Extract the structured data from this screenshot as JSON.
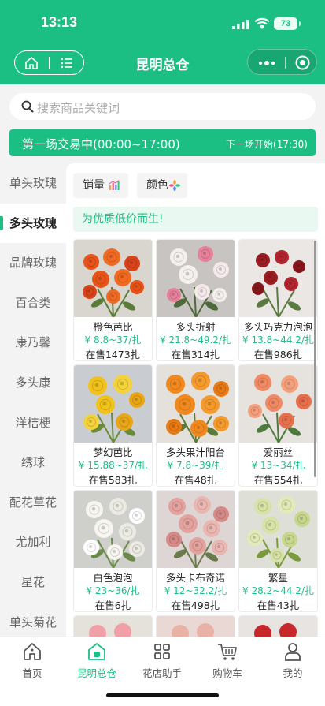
{
  "status_bar": {
    "time": "13:13",
    "battery": "73"
  },
  "header": {
    "title": "昆明总仓"
  },
  "search": {
    "placeholder": "搜索商品关键词"
  },
  "banner": {
    "left": "第一场交易中(00:00~17:00)",
    "right": "下一场开始(17:30)"
  },
  "sidebar": {
    "items": [
      {
        "label": "单头玫瑰"
      },
      {
        "label": "多头玫瑰",
        "active": true
      },
      {
        "label": "品牌玫瑰"
      },
      {
        "label": "百合类"
      },
      {
        "label": "康乃馨"
      },
      {
        "label": "多头康"
      },
      {
        "label": "洋桔梗"
      },
      {
        "label": "绣球"
      },
      {
        "label": "配花草花"
      },
      {
        "label": "尤加利"
      },
      {
        "label": "星花"
      },
      {
        "label": "单头菊花"
      }
    ]
  },
  "filters": {
    "sales": "销量",
    "color": "颜色"
  },
  "slogan": "为优质低价而生!",
  "products": [
    {
      "name": "橙色芭比",
      "price": "¥ 8.8~37/扎",
      "stock": "在售1473扎"
    },
    {
      "name": "多头折射",
      "price": "¥ 21.8~49.2/扎",
      "stock": "在售314扎"
    },
    {
      "name": "多头巧克力泡泡",
      "price": "¥ 13.8~44.2/扎",
      "stock": "在售986扎"
    },
    {
      "name": "梦幻芭比",
      "price": "¥ 15.88~37/扎",
      "stock": "在售583扎"
    },
    {
      "name": "多头果汁阳台",
      "price": "¥ 7.8~39/扎",
      "stock": "在售48扎"
    },
    {
      "name": "爱丽丝",
      "price": "¥ 13~34/扎",
      "stock": "在售554扎"
    },
    {
      "name": "白色泡泡",
      "price": "¥ 23~36/扎",
      "stock": "在售6扎"
    },
    {
      "name": "多头卡布奇诺",
      "price": "¥ 12~32.2/扎",
      "stock": "在售498扎"
    },
    {
      "name": "繁星",
      "price": "¥ 28.2~44.2/扎",
      "stock": "在售43扎"
    }
  ],
  "tabbar": {
    "items": [
      {
        "label": "首页",
        "icon": "home-icon"
      },
      {
        "label": "昆明总仓",
        "icon": "warehouse-icon",
        "active": true
      },
      {
        "label": "花店助手",
        "icon": "grid-icon"
      },
      {
        "label": "购物车",
        "icon": "cart-icon"
      },
      {
        "label": "我的",
        "icon": "user-icon"
      }
    ]
  },
  "colors": {
    "brand": "#1cbf83"
  }
}
